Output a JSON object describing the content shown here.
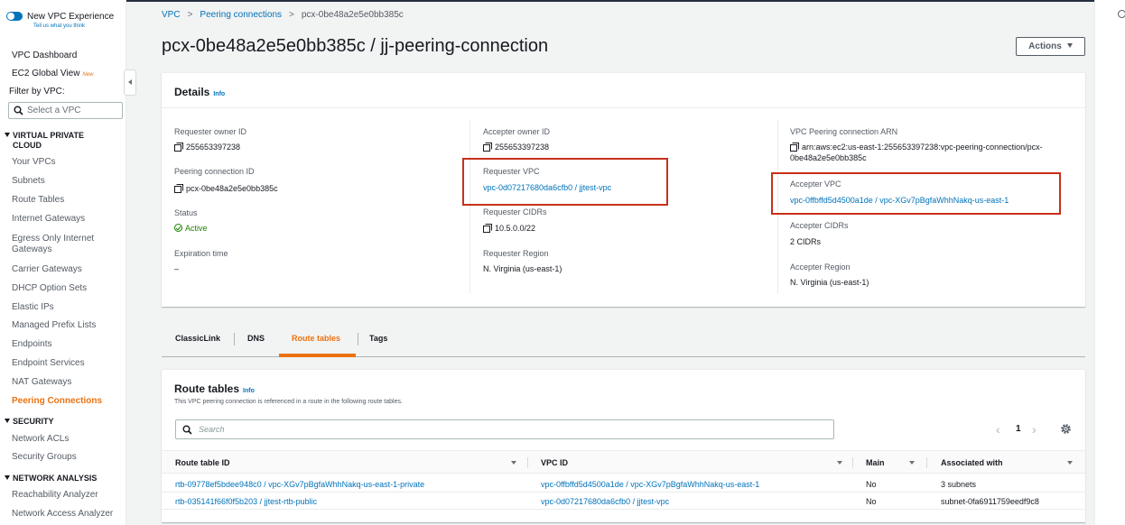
{
  "sidebar": {
    "experience_title": "New VPC Experience",
    "experience_link": "Tell us what you think",
    "top_items": [
      "VPC Dashboard",
      "EC2 Global View"
    ],
    "new_badge": "New",
    "filter_label": "Filter by VPC:",
    "filter_placeholder": "Select a VPC",
    "section_vpc_line1": "VIRTUAL PRIVATE",
    "section_vpc_line2": "CLOUD",
    "vpc_items": [
      "Your VPCs",
      "Subnets",
      "Route Tables",
      "Internet Gateways",
      "Egress Only Internet",
      "Gateways",
      "Carrier Gateways",
      "DHCP Option Sets",
      "Elastic IPs",
      "Managed Prefix Lists",
      "Endpoints",
      "Endpoint Services",
      "NAT Gateways",
      "Peering Connections"
    ],
    "section_security": "SECURITY",
    "security_items": [
      "Network ACLs",
      "Security Groups"
    ],
    "section_network": "NETWORK ANALYSIS",
    "network_items": [
      "Reachability Analyzer",
      "Network Access Analyzer"
    ],
    "accent_color": "#ec7211"
  },
  "breadcrumb": {
    "root": "VPC",
    "parent": "Peering connections",
    "current": "pcx-0be48a2e5e0bb385c",
    "separator": ">"
  },
  "page": {
    "title": "pcx-0be48a2e5e0bb385c / jj-peering-connection",
    "actions_label": "Actions"
  },
  "details": {
    "title": "Details",
    "info": "Info",
    "requester_owner_id_label": "Requester owner ID",
    "requester_owner_id": "255653397238",
    "peering_connection_id_label": "Peering connection ID",
    "peering_connection_id": "pcx-0be48a2e5e0bb385c",
    "status_label": "Status",
    "status": "Active",
    "expiration_label": "Expiration time",
    "expiration": "–",
    "accepter_owner_id_label": "Accepter owner ID",
    "accepter_owner_id": "255653397238",
    "requester_vpc_label": "Requester VPC",
    "requester_vpc": "vpc-0d07217680da6cfb0 / jjtest-vpc",
    "requester_cidrs_label": "Requester CIDRs",
    "requester_cidrs": "10.5.0.0/22",
    "requester_region_label": "Requester Region",
    "requester_region": "N. Virginia (us-east-1)",
    "arn_label": "VPC Peering connection ARN",
    "arn_line1": "arn:aws:ec2:us-east-1:255653397238:vpc-peering-connection/pcx-",
    "arn_line2": "0be48a2e5e0bb385c",
    "accepter_vpc_label": "Accepter VPC",
    "accepter_vpc": "vpc-0ffbffd5d4500a1de / vpc-XGv7pBgfaWhhNakq-us-east-1",
    "accepter_cidrs_label": "Accepter CIDRs",
    "accepter_cidrs": "2 CIDRs",
    "accepter_region_label": "Accepter Region",
    "accepter_region": "N. Virginia (us-east-1)"
  },
  "tabs": [
    "ClassicLink",
    "DNS",
    "Route tables",
    "Tags"
  ],
  "active_tab": "Route tables",
  "route_tables": {
    "title": "Route tables",
    "info": "Info",
    "description": "This VPC peering connection is referenced in a route in the following route tables.",
    "search_placeholder": "Search",
    "page": "1",
    "columns": [
      "Route table ID",
      "VPC ID",
      "Main",
      "Associated with"
    ],
    "rows": [
      {
        "route_table_id": "rtb-09778ef5bdee948c0 / vpc-XGv7pBgfaWhhNakq-us-east-1-private",
        "vpc_id": "vpc-0ffbffd5d4500a1de / vpc-XGv7pBgfaWhhNakq-us-east-1",
        "main": "No",
        "associated_with": "3 subnets"
      },
      {
        "route_table_id": "rtb-035141f66f0f5b203 / jjtest-rtb-public",
        "vpc_id": "vpc-0d07217680da6cfb0 / jjtest-vpc",
        "main": "No",
        "associated_with": "subnet-0fa6911759eedf9c8"
      }
    ]
  },
  "colors": {
    "link": "#0073bb",
    "highlight_box": "#c7301a",
    "active_status": "#1d8102"
  }
}
